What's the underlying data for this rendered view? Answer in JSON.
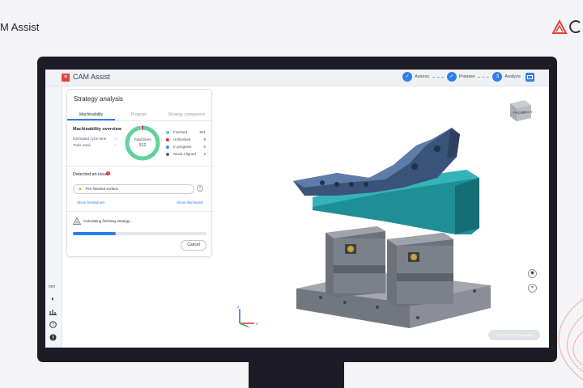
{
  "page": {
    "title": "M Assist"
  },
  "app": {
    "name": "CAM Assist",
    "steps": [
      {
        "label": "Assess",
        "number": ""
      },
      {
        "label": "Prepare",
        "number": ""
      },
      {
        "label": "Analyze",
        "number": "3"
      }
    ],
    "accent": "#2f80e8"
  },
  "panel": {
    "title": "Strategy analysis",
    "tabs": [
      "Machinability",
      "Program",
      "Strategy comparison"
    ],
    "active_tab": "Machinability",
    "overview": {
      "title": "Machinability overview",
      "rows": [
        {
          "label": "Estimated cycle time",
          "value": "--"
        },
        {
          "label": "Tools used",
          "value": "--"
        }
      ],
      "donut": {
        "label": "Total faces",
        "value": "512"
      },
      "legend": [
        {
          "label": "Finished",
          "value": "501",
          "color": "#5fd39b"
        },
        {
          "label": "Unfinished",
          "value": "9",
          "color": "#d8342c"
        },
        {
          "label": "In progress",
          "value": "0",
          "color": "#4a8fe0"
        },
        {
          "label": "Stock-Aligned",
          "value": "2",
          "color": "#5b6270"
        }
      ]
    },
    "issues": {
      "title": "Detected an issue",
      "count": "1",
      "item": "Pre-finished surface",
      "link_breakdown": "Show breakdown",
      "link_dismissed": "Show dismissed"
    },
    "status": {
      "text": "Calculating finishing strategy...",
      "progress": 0.32,
      "cancel_label": "Cancel"
    }
  },
  "rail": {
    "units": "mm",
    "icons": [
      "contrast-icon",
      "chart-icon",
      "help-icon",
      "info-icon"
    ]
  },
  "viewport": {
    "viewcube": {
      "front": "FRONT",
      "right": "RIGHT"
    },
    "axes": {
      "x": "x",
      "y": "y",
      "z": "z"
    },
    "primary_action": "Send to CAM package"
  }
}
